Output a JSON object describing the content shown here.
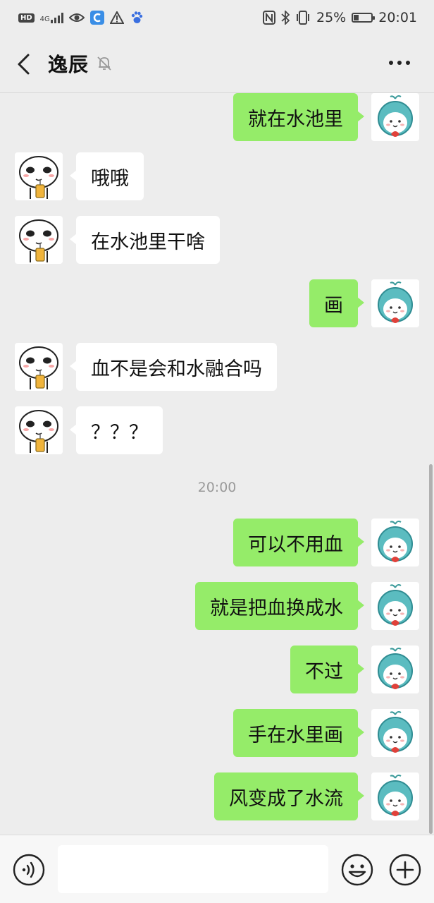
{
  "status_bar": {
    "hd": "HD",
    "network": "4G",
    "battery_text": "25%",
    "battery_level": 0.25,
    "time": "20:01"
  },
  "header": {
    "title": "逸辰",
    "icons": [
      "back-chevron-icon",
      "mute-bell-icon",
      "more-dots-icon"
    ]
  },
  "messages": [
    {
      "from": "me",
      "text": "就在水池里"
    },
    {
      "from": "them",
      "text": "哦哦"
    },
    {
      "from": "them",
      "text": "在水池里干啥"
    },
    {
      "from": "me",
      "text": "画"
    },
    {
      "from": "them",
      "text": "血不是会和水融合吗"
    },
    {
      "from": "them",
      "text": "？？？"
    },
    {
      "type": "time",
      "text": "20:00"
    },
    {
      "from": "me",
      "text": "可以不用血"
    },
    {
      "from": "me",
      "text": "就是把血换成水"
    },
    {
      "from": "me",
      "text": "不过"
    },
    {
      "from": "me",
      "text": "手在水里画"
    },
    {
      "from": "me",
      "text": "风变成了水流"
    }
  ],
  "input_bar": {
    "placeholder": "",
    "icons": [
      "voice-icon",
      "emoji-icon",
      "plus-icon"
    ]
  },
  "colors": {
    "background": "#ededed",
    "my_bubble": "#95ec69",
    "their_bubble": "#ffffff"
  }
}
